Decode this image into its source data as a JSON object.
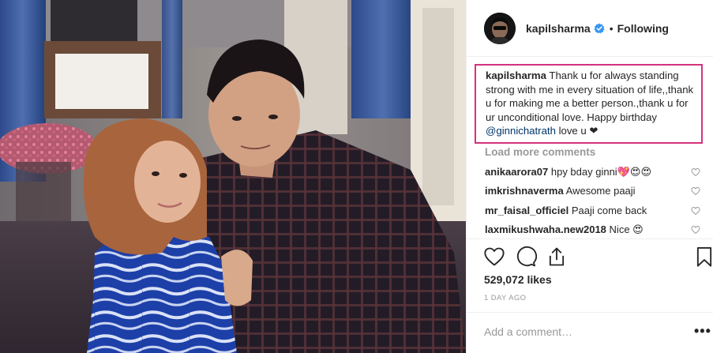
{
  "post": {
    "image_alt": "Selfie of a man in a dark checked shirt and a woman in a blue tie-dye top"
  },
  "header": {
    "username": "kapilsharma",
    "separator": "•",
    "follow_status": "Following"
  },
  "caption": {
    "username": "kapilsharma",
    "text": "Thank u for always standing strong with me in every situation of life,,thank u for making me a better person.,thank u for ur unconditional love. Happy birthday ",
    "mention": "@ginnichatrath",
    "suffix": " love u ❤"
  },
  "comments": {
    "load_more": "Load more comments",
    "items": [
      {
        "username": "anikaarora07",
        "text": "hpy bday ginni💖😍😍"
      },
      {
        "username": "imkrishnaverma",
        "text": "Awesome paaji"
      },
      {
        "username": "mr_faisal_officiel",
        "text": "Paaji come back"
      },
      {
        "username": "laxmikushwaha.new2018",
        "text": "Nice 😍"
      }
    ]
  },
  "stats": {
    "likes": "529,072 likes",
    "time": "1 DAY AGO"
  },
  "add_comment": {
    "placeholder": "Add a comment…",
    "more": "•••"
  },
  "colors": {
    "highlight_border": "#d6317d",
    "verified": "#3897f0",
    "muted": "#999999",
    "mention": "#003569"
  },
  "icons": {
    "like": "heart-icon",
    "comment": "comment-icon",
    "share": "share-icon",
    "save": "bookmark-icon"
  }
}
